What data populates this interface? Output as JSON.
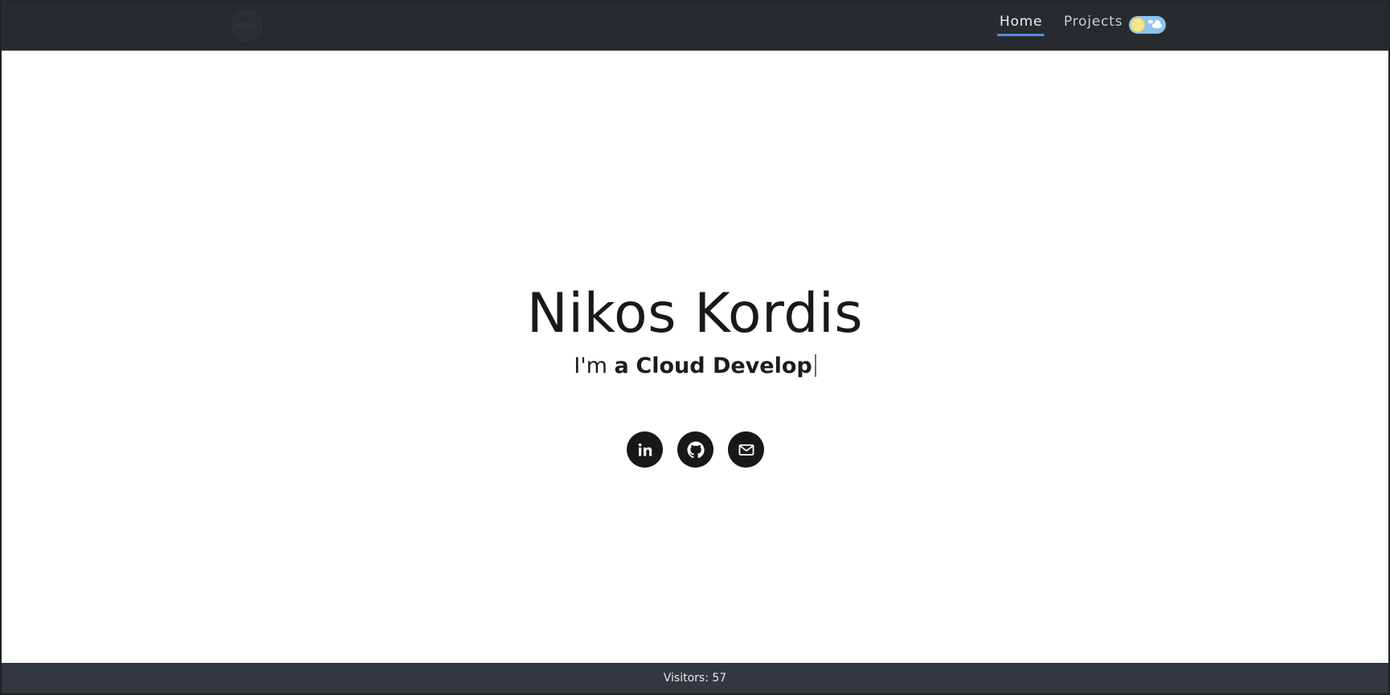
{
  "navbar": {
    "logo_text": "KORDIS",
    "links": [
      {
        "label": "Home",
        "active": true
      },
      {
        "label": "Projects",
        "active": false
      }
    ],
    "theme_toggle": {
      "mode": "light",
      "icons": [
        "sun-icon",
        "cloud-icon"
      ]
    }
  },
  "hero": {
    "name": "Nikos Kordis",
    "intro_prefix": "I'm",
    "intro_article": "a",
    "intro_role_typed": "Cloud Develop"
  },
  "social": [
    {
      "name": "linkedin",
      "icon": "linkedin-icon"
    },
    {
      "name": "github",
      "icon": "github-icon"
    },
    {
      "name": "email",
      "icon": "mail-icon"
    }
  ],
  "footer": {
    "visitors_label": "Visitors:",
    "visitors_count": "57"
  },
  "colors": {
    "navbar_bg": "#272b30",
    "active_underline": "#4f8fe0",
    "footer_bg": "#33383e",
    "text_dark": "#17191b",
    "icon_circle": "#16181a"
  }
}
